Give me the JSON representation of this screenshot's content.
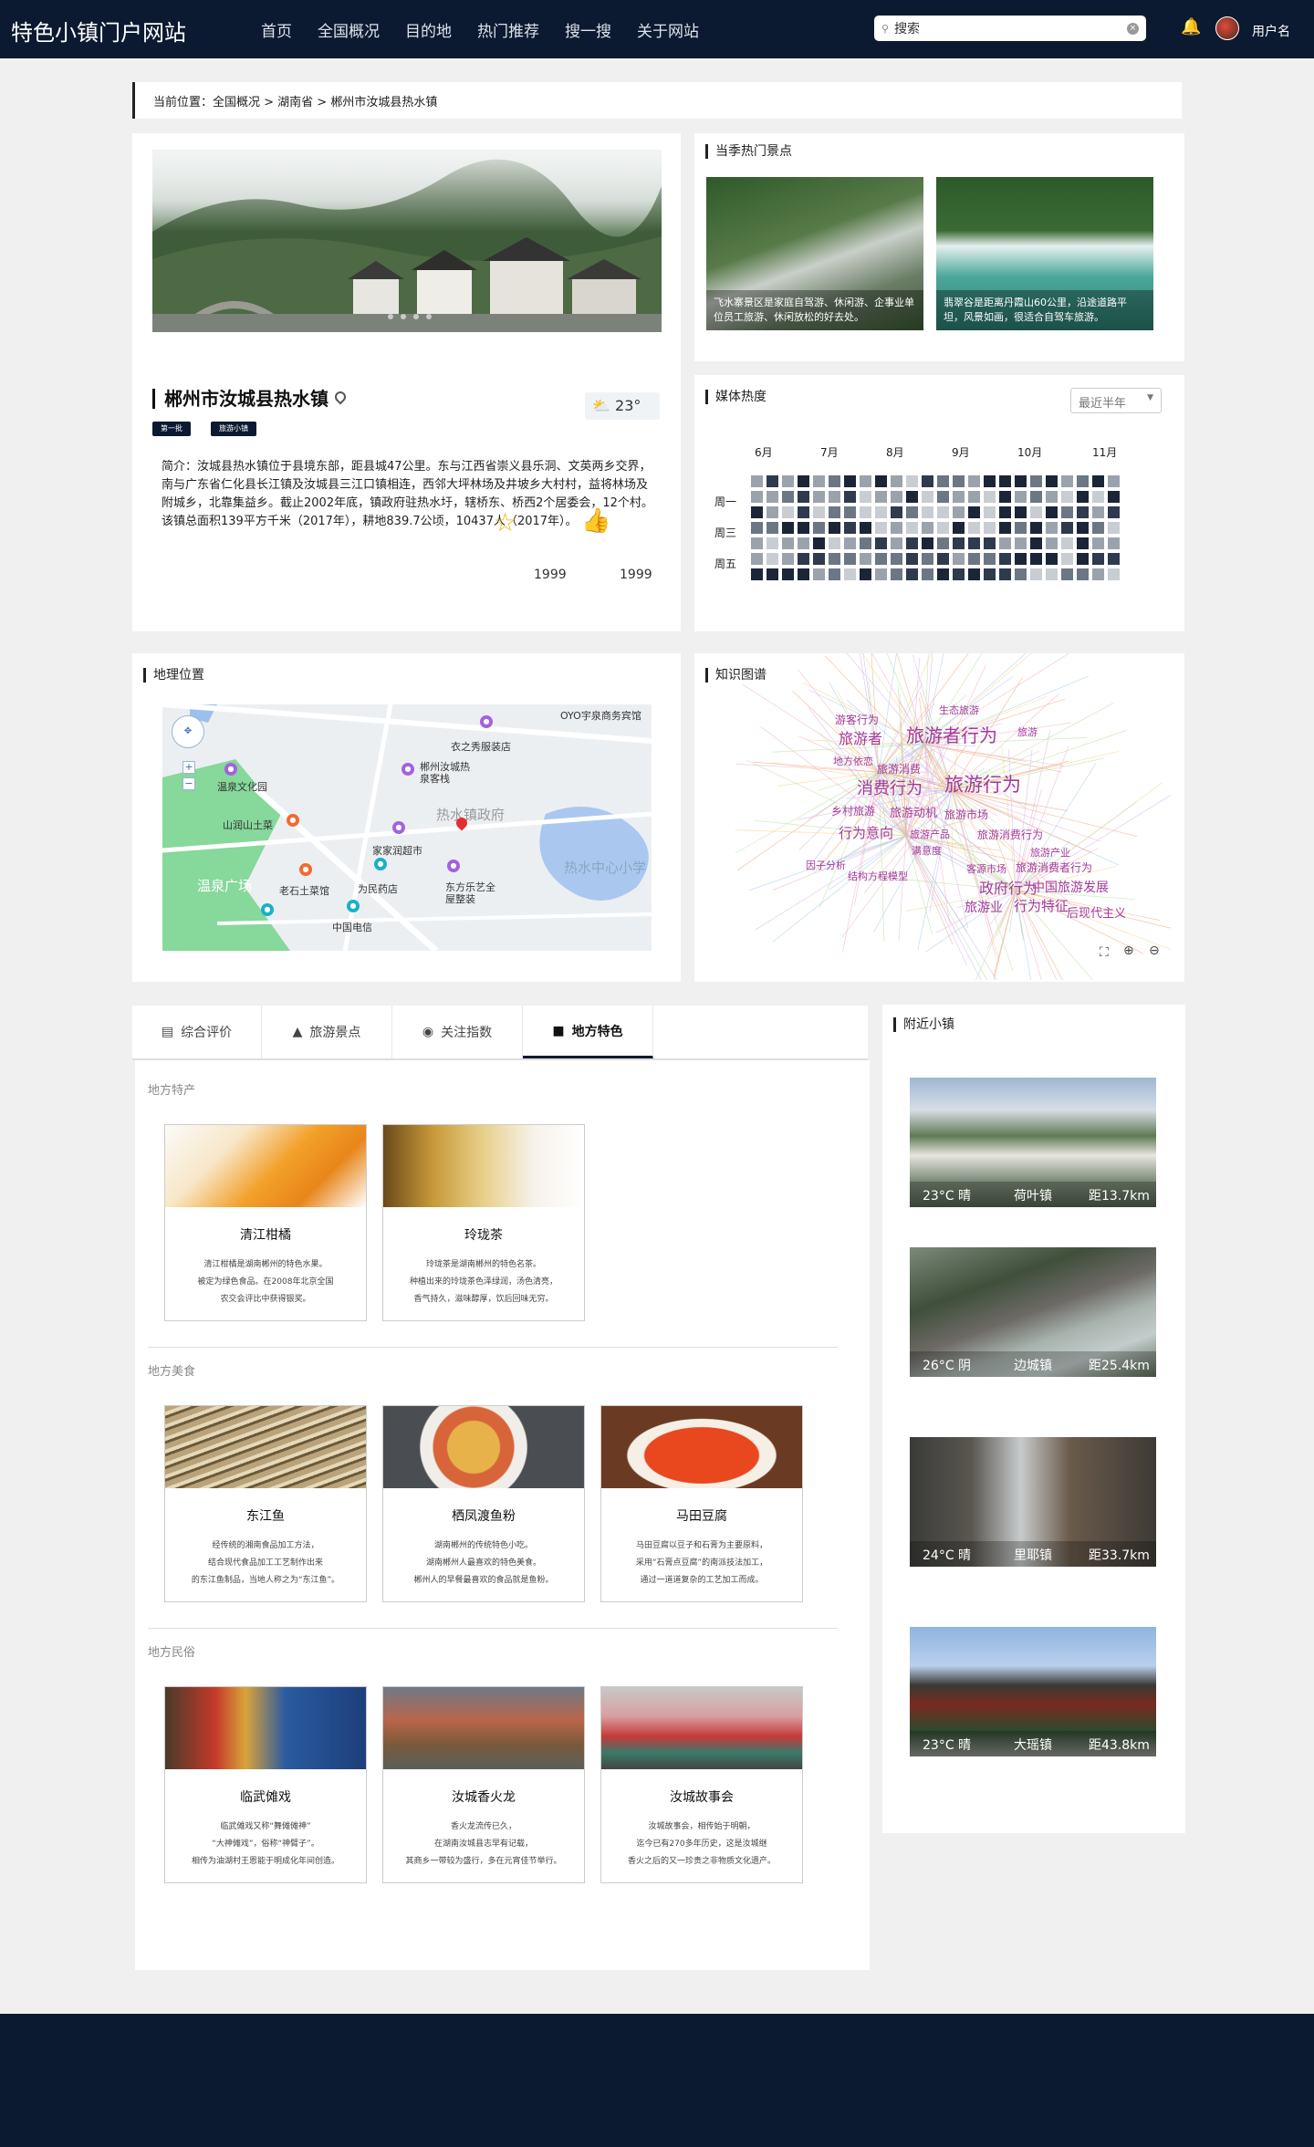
{
  "header": {
    "brand": "特色小镇门户网站",
    "nav": [
      "首页",
      "全国概况",
      "目的地",
      "热门推荐",
      "搜一搜",
      "关于网站"
    ],
    "search_value": "搜索",
    "username": "用户名"
  },
  "breadcrumb": "当前位置：全国概况 > 湖南省 > 郴州市汝城县热水镇",
  "town": {
    "title": "郴州市汝城县热水镇",
    "temp": "23°",
    "tags": [
      "第一批",
      "旅游小镇"
    ],
    "intro": "简介：汝城县热水镇位于县境东部，距县城47公里。东与江西省崇义县乐洞、文英两乡交界，南与广东省仁化县长江镇及汝城县三江口镇相连，西邻大坪林场及井坡乡大村村，益将林场及附城乡，北靠集益乡。截止2002年底，镇政府驻热水圩，辖桥东、桥西2个居委会，12个村。该镇总面积139平方千米（2017年），耕地839.7公顷，10437人（2017年）。",
    "stars": "1999",
    "likes": "1999"
  },
  "hot_spots": {
    "title": "当季热门景点",
    "items": [
      {
        "caption": "飞水寨景区是家庭自驾游、休闲游、企事业单位员工旅游、休闲放松的好去处。"
      },
      {
        "caption": "翡翠谷是距离丹霞山60公里，沿途道路平坦，风景如画，很适合自驾车旅游。"
      }
    ]
  },
  "media": {
    "title": "媒体热度",
    "select": "最近半年",
    "months": [
      "6月",
      "7月",
      "8月",
      "9月",
      "10月",
      "11月"
    ],
    "days": [
      "周一",
      "周三",
      "周五"
    ],
    "colors": [
      "#1a2538",
      "#6b7785",
      "#9aa3ad",
      "#c8cdd3",
      "#2e3a4d"
    ]
  },
  "geo": {
    "title": "地理位置",
    "pois": [
      "OYO宇泉商务宾馆",
      "衣之秀服装店",
      "郴州汝城热泉客栈",
      "温泉文化园",
      "热水镇政府",
      "山润山土菜",
      "家家润超市",
      "热水中心小学",
      "温泉广场",
      "老石土菜馆",
      "为民药店",
      "东方乐艺全屋整装",
      "中国电信"
    ]
  },
  "knowledge": {
    "title": "知识图谱",
    "words": [
      "游客行为",
      "生态旅游",
      "旅游者",
      "旅游者行为",
      "旅游",
      "地方依恋",
      "旅游消费",
      "消费行为",
      "旅游行为",
      "乡村旅游",
      "旅游动机",
      "旅游市场",
      "行为意向",
      "旅游产品",
      "旅游消费行为",
      "满意度",
      "旅游产业",
      "因子分析",
      "结构方程模型",
      "客源市场",
      "旅游消费者行为",
      "政府行为",
      "中国旅游发展",
      "旅游业",
      "行为特征",
      "后现代主义"
    ]
  },
  "tabs": [
    "综合评价",
    "旅游景点",
    "关注指数",
    "地方特色"
  ],
  "features": {
    "specialty_title": "地方特产",
    "specialty": [
      {
        "name": "清江柑橘",
        "desc": [
          "清江柑橘是湖南郴州的特色水果。",
          "被定为绿色食品。在2008年北京全国",
          "农交会评比中获得银奖。"
        ]
      },
      {
        "name": "玲珑茶",
        "desc": [
          "玲珑茶是湖南郴州的特色名茶。",
          "种植出来的玲珑茶色泽绿润，汤色清亮，",
          "香气持久，滋味醇厚，饮后回味无穷。"
        ]
      }
    ],
    "food_title": "地方美食",
    "food": [
      {
        "name": "东江鱼",
        "desc": [
          "经传统的湘南食品加工方法，",
          "结合现代食品加工工艺制作出来",
          "的东江鱼制品，当地人称之为“东江鱼”。"
        ]
      },
      {
        "name": "栖凤渡鱼粉",
        "desc": [
          "湖南郴州的传统特色小吃。",
          "湖南郴州人最喜欢的特色美食。",
          "郴州人的早餐最喜欢的食品就是鱼粉。"
        ]
      },
      {
        "name": "马田豆腐",
        "desc": [
          "马田豆腐以豆子和石膏为主要原料，",
          "采用“石膏点豆腐”的南派技法加工，",
          "通过一道道复杂的工艺加工而成。"
        ]
      }
    ],
    "folk_title": "地方民俗",
    "folk": [
      {
        "name": "临武傩戏",
        "desc": [
          "临武傩戏又称“舞傩傩神”",
          "“大神傩戏”，俗称“神臂子”。",
          "相传为油湖村王恩能于明成化年间创造。"
        ]
      },
      {
        "name": "汝城香火龙",
        "desc": [
          "香火龙流传已久，",
          "在湖南汝城县志早有记载，",
          "其商乡一带较为盛行，多在元宵佳节举行。"
        ]
      },
      {
        "name": "汝城故事会",
        "desc": [
          "汝城故事会，相传始于明朝，",
          "迄今已有270多年历史，这是汝城继",
          "香火之后的又一珍贵之非物质文化遗产。"
        ]
      }
    ]
  },
  "nearby": {
    "title": "附近小镇",
    "towns": [
      {
        "weather": "23°C 晴",
        "name": "荷叶镇",
        "dist": "距13.7km"
      },
      {
        "weather": "26°C 阴",
        "name": "边城镇",
        "dist": "距25.4km"
      },
      {
        "weather": "24°C 晴",
        "name": "里耶镇",
        "dist": "距33.7km"
      },
      {
        "weather": "23°C 晴",
        "name": "大瑶镇",
        "dist": "距43.8km"
      }
    ]
  }
}
